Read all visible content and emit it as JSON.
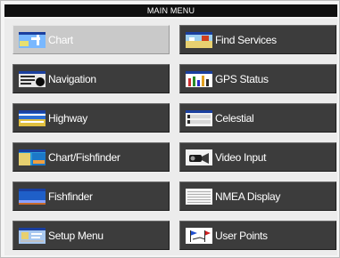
{
  "title": "MAIN MENU",
  "menu": {
    "left": [
      {
        "label": "Chart",
        "icon": "chart-icon",
        "selected": true
      },
      {
        "label": "Navigation",
        "icon": "navigation-icon"
      },
      {
        "label": "Highway",
        "icon": "highway-icon"
      },
      {
        "label": "Chart/Fishfinder",
        "icon": "chart-fishfinder-icon"
      },
      {
        "label": "Fishfinder",
        "icon": "fishfinder-icon"
      },
      {
        "label": "Setup Menu",
        "icon": "setup-menu-icon"
      }
    ],
    "right": [
      {
        "label": "Find Services",
        "icon": "find-services-icon"
      },
      {
        "label": "GPS Status",
        "icon": "gps-status-icon"
      },
      {
        "label": "Celestial",
        "icon": "celestial-icon"
      },
      {
        "label": "Video Input",
        "icon": "video-input-icon"
      },
      {
        "label": "NMEA Display",
        "icon": "nmea-display-icon"
      },
      {
        "label": "User Points",
        "icon": "user-points-icon"
      }
    ]
  },
  "colors": {
    "button": "#3c3c3c",
    "button_selected": "#c9c9c9",
    "title_bar": "#101010",
    "panel": "#ececec"
  }
}
